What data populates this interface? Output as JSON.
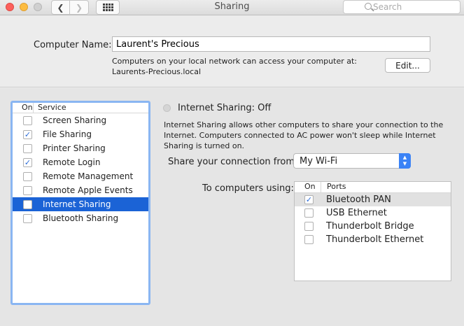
{
  "window": {
    "title": "Sharing",
    "search_placeholder": "Search"
  },
  "computer_name": {
    "label": "Computer Name:",
    "value": "Laurent's Precious",
    "description_line1": "Computers on your local network can access your computer at:",
    "description_line2": "Laurents-Precious.local",
    "edit_label": "Edit..."
  },
  "services": {
    "header_on": "On",
    "header_service": "Service",
    "items": [
      {
        "label": "Screen Sharing",
        "checked": false,
        "selected": false
      },
      {
        "label": "File Sharing",
        "checked": true,
        "selected": false
      },
      {
        "label": "Printer Sharing",
        "checked": false,
        "selected": false
      },
      {
        "label": "Remote Login",
        "checked": true,
        "selected": false
      },
      {
        "label": "Remote Management",
        "checked": false,
        "selected": false
      },
      {
        "label": "Remote Apple Events",
        "checked": false,
        "selected": false
      },
      {
        "label": "Internet Sharing",
        "checked": false,
        "selected": true
      },
      {
        "label": "Bluetooth Sharing",
        "checked": false,
        "selected": false
      }
    ]
  },
  "internet_sharing": {
    "status": "Internet Sharing: Off",
    "description": "Internet Sharing allows other computers to share your connection to the Internet. Computers connected to AC power won't sleep while Internet Sharing is turned on.",
    "share_from_label": "Share your connection from:",
    "share_from_value": "My Wi-Fi",
    "to_computers_label": "To computers using:",
    "ports_header_on": "On",
    "ports_header_ports": "Ports",
    "ports": [
      {
        "label": "Bluetooth PAN",
        "checked": true
      },
      {
        "label": "USB Ethernet",
        "checked": false
      },
      {
        "label": "Thunderbolt Bridge",
        "checked": false
      },
      {
        "label": "Thunderbolt Ethernet",
        "checked": false
      }
    ]
  },
  "colors": {
    "accent": "#1b63d6",
    "focus_ring": "#8ab6f2"
  }
}
